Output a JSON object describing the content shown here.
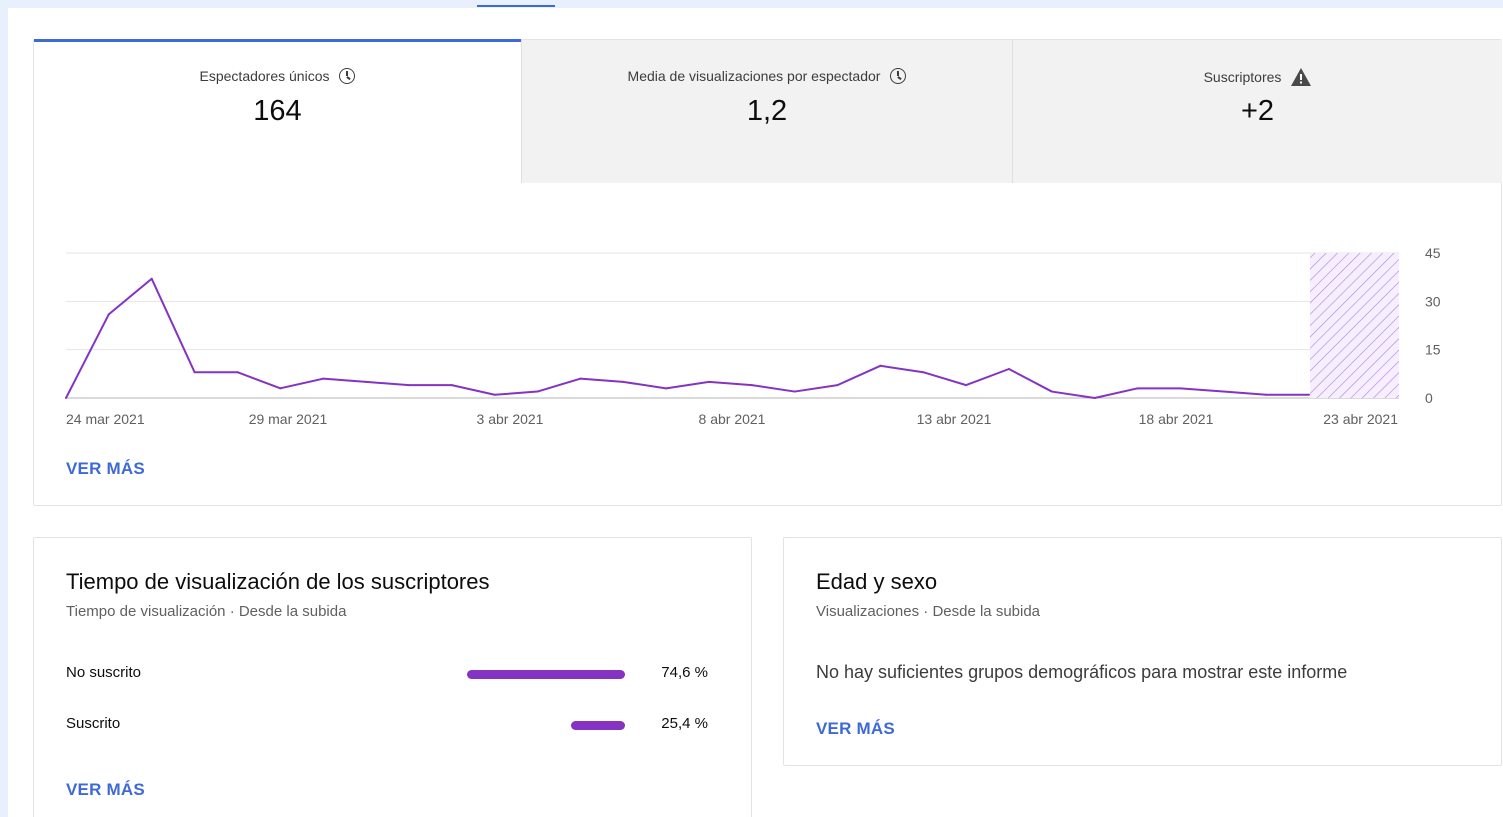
{
  "tabs": [
    {
      "label": "Espectadores únicos",
      "value": "164",
      "icon": "clock-icon"
    },
    {
      "label": "Media de visualizaciones por espectador",
      "value": "1,2",
      "icon": "clock-icon"
    },
    {
      "label": "Suscriptores",
      "value": "+2",
      "icon": "warning-icon"
    }
  ],
  "chart_data": {
    "type": "line",
    "x": [
      "24 mar 2021",
      "25 mar 2021",
      "26 mar 2021",
      "27 mar 2021",
      "28 mar 2021",
      "29 mar 2021",
      "30 mar 2021",
      "31 mar 2021",
      "1 abr 2021",
      "2 abr 2021",
      "3 abr 2021",
      "4 abr 2021",
      "5 abr 2021",
      "6 abr 2021",
      "7 abr 2021",
      "8 abr 2021",
      "9 abr 2021",
      "10 abr 2021",
      "11 abr 2021",
      "12 abr 2021",
      "13 abr 2021",
      "14 abr 2021",
      "15 abr 2021",
      "16 abr 2021",
      "17 abr 2021",
      "18 abr 2021",
      "19 abr 2021",
      "20 abr 2021",
      "21 abr 2021",
      "22 abr 2021"
    ],
    "series": [
      {
        "values": [
          0,
          26,
          37,
          8,
          8,
          3,
          6,
          5,
          4,
          4,
          1,
          2,
          6,
          5,
          3,
          5,
          4,
          2,
          4,
          10,
          8,
          4,
          9,
          2,
          0,
          3,
          3,
          2,
          1,
          1
        ]
      }
    ],
    "xticks": [
      "24 mar 2021",
      "29 mar 2021",
      "3 abr 2021",
      "8 abr 2021",
      "13 abr 2021",
      "18 abr 2021",
      "23 abr 2021"
    ],
    "yticks": [
      0,
      15,
      30,
      45
    ],
    "ylim": [
      0,
      45
    ],
    "pending_period": [
      "22 abr 2021",
      "23 abr 2021"
    ],
    "line_color": "#8433c2",
    "grid": true
  },
  "main_card": {
    "see_more": "VER MÁS"
  },
  "subscribers_card": {
    "title": "Tiempo de visualización de los suscriptores",
    "subtitle": "Tiempo de visualización · Desde la subida",
    "rows": [
      {
        "label": "No suscrito",
        "pct_text": "74,6 %",
        "pct": 74.6
      },
      {
        "label": "Suscrito",
        "pct_text": "25,4 %",
        "pct": 25.4
      }
    ],
    "see_more": "VER MÁS"
  },
  "demographics_card": {
    "title": "Edad y sexo",
    "subtitle": "Visualizaciones · Desde la subida",
    "message": "No hay suficientes grupos demográficos para mostrar este informe",
    "see_more": "VER MÁS"
  },
  "colors": {
    "accent": "#3e6ad8",
    "series": "#8433c2"
  }
}
